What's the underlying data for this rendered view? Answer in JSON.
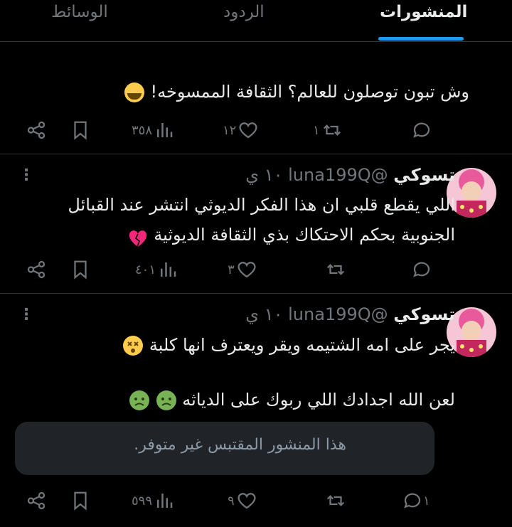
{
  "tabs": [
    {
      "label": "المنشورات",
      "active": true
    },
    {
      "label": "الردود",
      "active": false
    },
    {
      "label": "الوسائط",
      "active": false
    }
  ],
  "colors": {
    "accent": "#1d9bf0",
    "muted": "#71767b",
    "text": "#e7e9ea",
    "background": "#000000"
  },
  "posts": [
    {
      "text_lines": [
        "وش تبون توصلون للعالم؟ الثقافة الممسوخه!"
      ],
      "emojis": [
        "loudly-crying-face"
      ],
      "reply_count": "",
      "repost_count": "١",
      "like_count": "١٢",
      "view_count": "٣٥٨"
    },
    {
      "name": "تسوكي",
      "handle": "@luna199Q",
      "time": "١٠ ي",
      "text_lines": [
        "اللي يقطع قلبي ان هذا الفكر الديوثي انتشر عند القبائل",
        "الجنوبية بحكم الاحتكاك بذي الثقافة الديوثية"
      ],
      "emojis": [
        "broken-heart"
      ],
      "reply_count": "",
      "repost_count": "",
      "like_count": "٣",
      "view_count": "٤٠١"
    },
    {
      "name": "تسوكي",
      "handle": "@luna199Q",
      "time": "١٠ ي",
      "text_lines": [
        "يجر على امه الشتيمه ويقر ويعترف انها كلبة",
        "لعن الله اجدادك اللي ربوك على الدياثه"
      ],
      "emojis": [
        "dizzy-face",
        "nauseated-face",
        "nauseated-face"
      ],
      "quote": "هذا المنشور المقتبس غير متوفر.",
      "reply_count": "١",
      "repost_count": "",
      "like_count": "٩",
      "view_count": "٥٩٩"
    }
  ],
  "icons": {
    "reply": "reply-icon",
    "repost": "repost-icon",
    "like": "heart-icon",
    "views": "views-icon",
    "bookmark": "bookmark-icon",
    "share": "share-icon",
    "more": "more-icon"
  }
}
